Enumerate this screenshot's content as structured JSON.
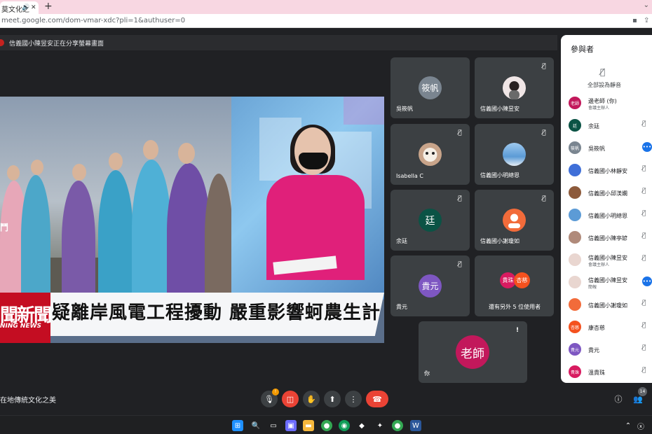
{
  "browser": {
    "tab_title": "莫文化之",
    "url": "meet.google.com/dom-vmar-xdc?pli=1&authuser=0"
  },
  "presenter_banner": "信義國小陳昱安正在分享螢幕畫面",
  "shared_screen": {
    "headline": "疑離岸風電工程擾動 嚴重影響蚵農生計",
    "channel_big": "聞新聞",
    "channel_small": "NING NEWS",
    "corner_logo": "鬥"
  },
  "tiles": [
    {
      "name": "吳筱帆",
      "avatar_text": "筱帆",
      "avatar_color": "#7a8590",
      "muted": false
    },
    {
      "name": "信義國小陳昱安",
      "avatar_text": "",
      "avatar_color": "#f0e6e6",
      "muted": true
    },
    {
      "name": "Isabella C",
      "avatar_text": "",
      "avatar_color": "#c8a48a",
      "muted": true
    },
    {
      "name": "信義國小明總恩",
      "avatar_text": "",
      "avatar_color": "#5c9bd6",
      "muted": true
    },
    {
      "name": "余廷",
      "avatar_text": "廷",
      "avatar_color": "#0b5345",
      "muted": true
    },
    {
      "name": "信義國小謝瓊如",
      "avatar_text": "",
      "avatar_color": "#f26b3a",
      "muted": true
    },
    {
      "name": "貴元",
      "avatar_text": "貴元",
      "avatar_color": "#7e57c2",
      "muted": true
    },
    {
      "name": "還有另外 5 位使用者",
      "avatar_text": "",
      "avatar_color": "",
      "muted": false
    },
    {
      "name": "你",
      "avatar_text": "老師",
      "avatar_color": "#c2185b",
      "muted": false
    }
  ],
  "more_users": {
    "a1": "貴珠",
    "a2": "杏慈"
  },
  "sidebar": {
    "title": "參與者",
    "mute_all": "全部設為靜音",
    "participants": [
      {
        "name": "邊老師 (你)",
        "role": "會議主辦人",
        "avatar": "老師",
        "color": "#c2185b",
        "mic": "none"
      },
      {
        "name": "余廷",
        "role": "",
        "avatar": "廷",
        "color": "#0b5345",
        "mic": "muted"
      },
      {
        "name": "吳筱帆",
        "role": "",
        "avatar": "筱帆",
        "color": "#7a8590",
        "mic": "speaking"
      },
      {
        "name": "信義國小林靜安",
        "role": "",
        "avatar": "",
        "color": "#3f6fd8",
        "mic": "muted"
      },
      {
        "name": "信義國小邱渼嫻",
        "role": "",
        "avatar": "",
        "color": "#8d5a3b",
        "mic": "muted"
      },
      {
        "name": "信義國小明總恩",
        "role": "",
        "avatar": "",
        "color": "#5c9bd6",
        "mic": "muted"
      },
      {
        "name": "信義國小陳亭諺",
        "role": "",
        "avatar": "",
        "color": "#b08a7a",
        "mic": "muted"
      },
      {
        "name": "信義國小陳昱安",
        "role": "會議主辦人",
        "avatar": "",
        "color": "#e9d6d0",
        "mic": "muted"
      },
      {
        "name": "信義國小陳昱安",
        "role": "簡報",
        "avatar": "",
        "color": "#e9d6d0",
        "mic": "speaking"
      },
      {
        "name": "信義國小謝瓊如",
        "role": "",
        "avatar": "",
        "color": "#f26b3a",
        "mic": "muted"
      },
      {
        "name": "康杏慈",
        "role": "",
        "avatar": "杏慈",
        "color": "#f4511e",
        "mic": "muted"
      },
      {
        "name": "貴元",
        "role": "",
        "avatar": "貴元",
        "color": "#7e57c2",
        "mic": "muted"
      },
      {
        "name": "溫貴珠",
        "role": "",
        "avatar": "貴珠",
        "color": "#d81b60",
        "mic": "muted"
      }
    ]
  },
  "meeting_title": "在地傳統文化之美",
  "participant_count": "14",
  "mic_badge": "!"
}
